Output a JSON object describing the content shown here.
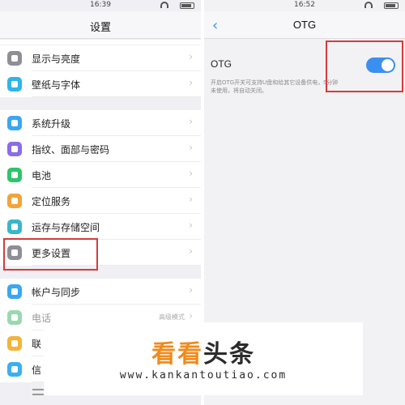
{
  "left": {
    "time": "16:39",
    "title": "设置",
    "group1": [
      {
        "label": "显示与亮度",
        "icon": "brightness-icon",
        "color": "#8e8e96"
      },
      {
        "label": "壁纸与字体",
        "icon": "text-icon",
        "color": "#2fb5e8"
      }
    ],
    "group2": [
      {
        "label": "系统升级",
        "icon": "update-icon",
        "color": "#3aa7f0"
      },
      {
        "label": "指纹、面部与密码",
        "icon": "fingerprint-icon",
        "color": "#8a6be8"
      },
      {
        "label": "电池",
        "icon": "battery-icon",
        "color": "#2ec46a"
      },
      {
        "label": "定位服务",
        "icon": "location-icon",
        "color": "#f2a33a"
      },
      {
        "label": "运存与存储空间",
        "icon": "storage-icon",
        "color": "#3ab6c9"
      },
      {
        "label": "更多设置",
        "icon": "wrench-icon",
        "color": "#8e8e96"
      }
    ],
    "group3": [
      {
        "label": "帐户与同步",
        "icon": "account-icon",
        "color": "#3aa7f0"
      },
      {
        "label": "电话",
        "icon": "phone-icon",
        "color": "#9ad8b0",
        "value": "高级模式"
      },
      {
        "label": "联",
        "icon": "contacts-icon",
        "color": "#f2b43a"
      },
      {
        "label": "信",
        "icon": "message-icon",
        "color": "#3ab0f0"
      }
    ]
  },
  "right": {
    "time": "16:52",
    "title": "OTG",
    "otg_label": "OTG",
    "otg_desc": "开启OTG开关可支持U盘和给其它设备供电，5分钟未使用，将自动关闭。",
    "otg_on": true
  },
  "watermark": {
    "title_a": "看看",
    "title_b": "头条",
    "url": "www.kankantoutiao.com"
  },
  "colors": {
    "accent": "#3b8ff0",
    "highlight": "#d63b3b"
  }
}
